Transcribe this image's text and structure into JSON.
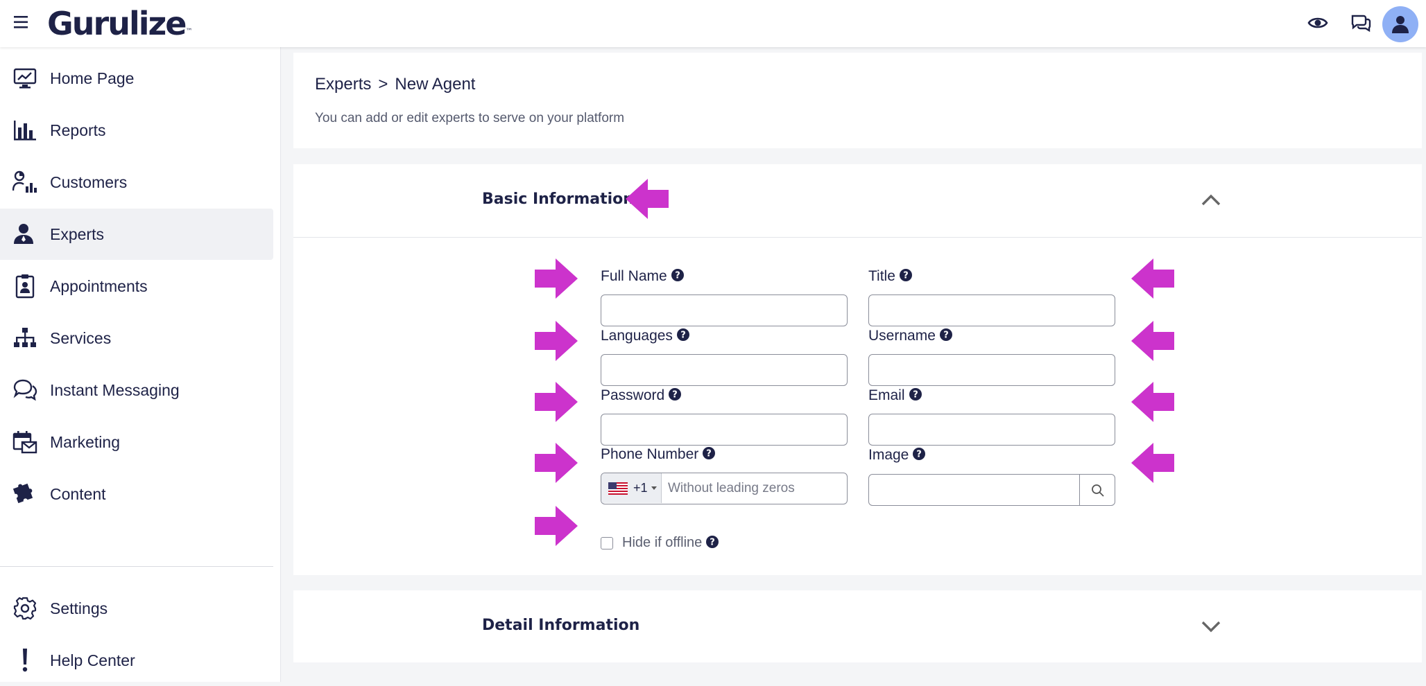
{
  "app": {
    "logo": "Gurulize",
    "logo_tm": "™"
  },
  "topbar": {
    "icons": [
      "eye-icon",
      "chat-icon",
      "user-icon"
    ]
  },
  "sidebar": {
    "items": [
      {
        "label": "Home Page",
        "icon": "monitor-chart-icon",
        "active": false
      },
      {
        "label": "Reports",
        "icon": "bar-chart-icon",
        "active": false
      },
      {
        "label": "Customers",
        "icon": "customers-chart-icon",
        "active": false
      },
      {
        "label": "Experts",
        "icon": "expert-user-icon",
        "active": true
      },
      {
        "label": "Appointments",
        "icon": "clipboard-badge-icon",
        "active": false
      },
      {
        "label": "Services",
        "icon": "sitemap-icon",
        "active": false
      },
      {
        "label": "Instant Messaging",
        "icon": "speech-bubbles-icon",
        "active": false
      },
      {
        "label": "Marketing",
        "icon": "calendar-mail-icon",
        "active": false
      },
      {
        "label": "Content",
        "icon": "puzzle-icon",
        "active": false
      }
    ],
    "bottom_items": [
      {
        "label": "Settings",
        "icon": "gear-icon"
      },
      {
        "label": "Help Center",
        "icon": "exclamation-icon"
      }
    ]
  },
  "breadcrumb": {
    "parent": "Experts",
    "separator": ">",
    "current": "New Agent"
  },
  "page": {
    "subtitle": "You can add or edit experts to serve on your platform"
  },
  "basic_section": {
    "title": "Basic Information",
    "fields": {
      "full_name": {
        "label": "Full Name",
        "value": ""
      },
      "title": {
        "label": "Title",
        "value": ""
      },
      "languages": {
        "label": "Languages",
        "value": ""
      },
      "username": {
        "label": "Username",
        "value": ""
      },
      "password": {
        "label": "Password",
        "value": ""
      },
      "email": {
        "label": "Email",
        "value": ""
      },
      "phone": {
        "label": "Phone Number",
        "country_flag": "us-flag-icon",
        "dial_code": "+1",
        "placeholder": "Without leading zeros"
      },
      "image": {
        "label": "Image",
        "value": ""
      }
    },
    "hide_if_offline": {
      "label": "Hide if offline",
      "checked": false
    }
  },
  "detail_section": {
    "title": "Detail Information"
  },
  "colors": {
    "accent_arrow": "#cc33cc",
    "navy": "#1e2247",
    "avatar_bg": "#8fb0f5",
    "page_bg": "#f4f5f7"
  }
}
